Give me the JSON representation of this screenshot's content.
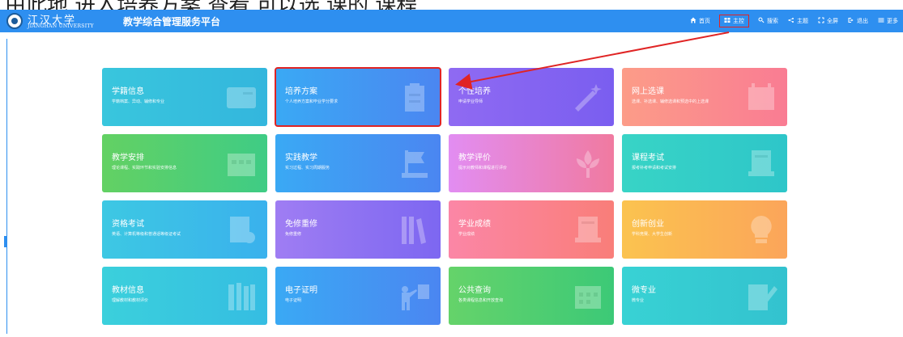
{
  "caption": "由此地 进入培养方案 查看 可以选 课的 课程",
  "header": {
    "logo_cn": "江汉大学",
    "logo_en": "JIANGHAN UNIVERSITY",
    "system_title": "教学综合管理服务平台",
    "nav": [
      {
        "label": "首页",
        "icon": "home-icon"
      },
      {
        "label": "主控",
        "icon": "windows-icon",
        "active": true
      },
      {
        "label": "搜索",
        "icon": "search-icon"
      },
      {
        "label": "主题",
        "icon": "share-icon"
      },
      {
        "label": "全屏",
        "icon": "fullscreen-icon"
      },
      {
        "label": "退出",
        "icon": "logout-icon"
      },
      {
        "label": "更多",
        "icon": "menu-icon"
      }
    ]
  },
  "tiles": [
    {
      "title": "学籍信息",
      "desc": "学籍档案、异动、辅修和专业",
      "icon": "id-card-icon",
      "gradient": [
        "#39c6dd",
        "#33b6dd"
      ]
    },
    {
      "title": "培养方案",
      "desc": "个人培养方案和毕业学分要求",
      "icon": "clipboard-icon",
      "gradient": [
        "#3aa9f4",
        "#4b86f1"
      ]
    },
    {
      "title": "个性培养",
      "desc": "申请学业导师",
      "icon": "magic-wand-icon",
      "gradient": [
        "#8f6af2",
        "#7a5ef0"
      ]
    },
    {
      "title": "网上选课",
      "desc": "选课、补选课、辅修选课和预选中的上选课",
      "icon": "calendar-icon",
      "gradient": [
        "#fc9c88",
        "#f97c93"
      ]
    },
    {
      "title": "教学安排",
      "desc": "理论课程、实践环节和实验安排信息",
      "icon": "schedule-icon",
      "gradient": [
        "#63d163",
        "#3fcc85"
      ]
    },
    {
      "title": "实践教学",
      "desc": "实习过程、实习周期服务",
      "icon": "flag-icon",
      "gradient": [
        "#3aa9f4",
        "#4b86f1"
      ]
    },
    {
      "title": "教学评价",
      "desc": "提示对教师和课程进行评价",
      "icon": "flower-icon",
      "gradient": [
        "#e28df2",
        "#f07aa0"
      ]
    },
    {
      "title": "课程考试",
      "desc": "报考补考申请和考试安排",
      "icon": "scroll-icon",
      "gradient": [
        "#38d4c6",
        "#2ec6c9"
      ]
    },
    {
      "title": "资格考试",
      "desc": "英语、计算机等级和普通话等级证考试",
      "icon": "certificate-icon",
      "gradient": [
        "#3dc8e3",
        "#3ab1ed"
      ]
    },
    {
      "title": "免修重修",
      "desc": "免修重修",
      "icon": "books-icon",
      "gradient": [
        "#9f7df3",
        "#7d67f1"
      ]
    },
    {
      "title": "学业成绩",
      "desc": "学业成绩",
      "icon": "scroll-icon",
      "gradient": [
        "#fb86a6",
        "#f97e79"
      ]
    },
    {
      "title": "创新创业",
      "desc": "学科竞赛、大学生创新",
      "icon": "lightbulb-icon",
      "gradient": [
        "#fbc34f",
        "#fba55a"
      ]
    },
    {
      "title": "教材信息",
      "desc": "理解教材和教材评价",
      "icon": "bookshelf-icon",
      "gradient": [
        "#3bd0dc",
        "#35bde2"
      ]
    },
    {
      "title": "电子证明",
      "desc": "电子证明",
      "icon": "teacher-icon",
      "gradient": [
        "#3aa9f4",
        "#4b86f1"
      ]
    },
    {
      "title": "公共查询",
      "desc": "各类课程信息和开放查询",
      "icon": "calendar-grid-icon",
      "gradient": [
        "#65d36a",
        "#3cc977"
      ]
    },
    {
      "title": "微专业",
      "desc": "微专业",
      "icon": "edit-icon",
      "gradient": [
        "#38d2d4",
        "#33c2cf"
      ]
    }
  ]
}
